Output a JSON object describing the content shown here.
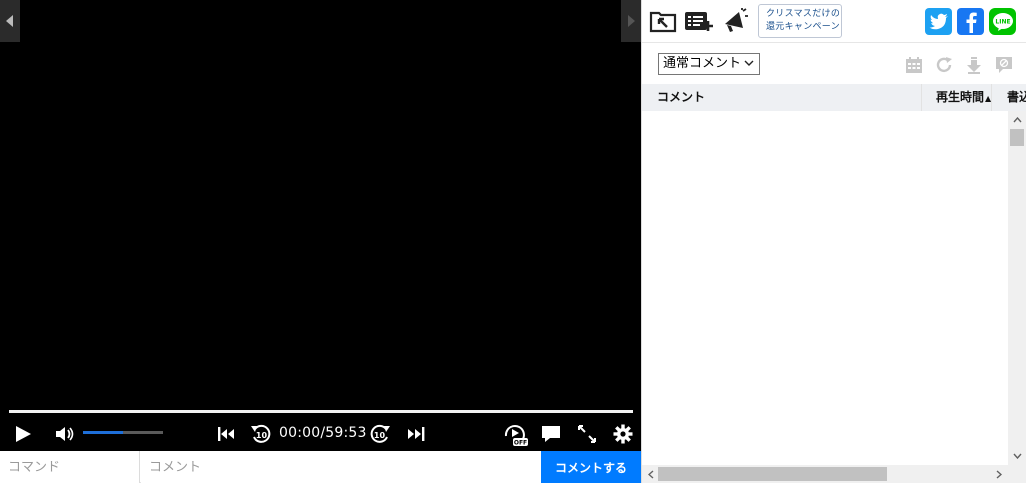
{
  "player": {
    "timecode": "00:00/59:53",
    "seek_progress": 0.0,
    "volume_level": 0.5,
    "colors": {
      "background": "#000000",
      "volume_fill": "#1e6fd9"
    },
    "icons": [
      "play-icon",
      "volume-icon",
      "previous-icon",
      "rewind-10-icon",
      "forward-10-icon",
      "next-icon",
      "autoplay-off-icon",
      "comment-toggle-icon",
      "fullscreen-icon",
      "settings-icon"
    ]
  },
  "comment_bar": {
    "command_placeholder": "コマンド",
    "comment_placeholder": "コメント",
    "submit_label": "コメントする",
    "submit_color": "#007bff"
  },
  "panel": {
    "promo_line1": "クリスマスだけの",
    "promo_line2": "還元キャンペーン",
    "sns": [
      {
        "name": "twitter",
        "color": "#1da1f2"
      },
      {
        "name": "facebook",
        "color": "#1877f2"
      },
      {
        "name": "line",
        "color": "#00c300",
        "label": "LINE"
      }
    ],
    "comment_type_selected": "通常コメント",
    "table": {
      "columns": [
        "コメント",
        "再生時間",
        "書込"
      ],
      "sort_indicator": "▲",
      "rows": []
    }
  }
}
